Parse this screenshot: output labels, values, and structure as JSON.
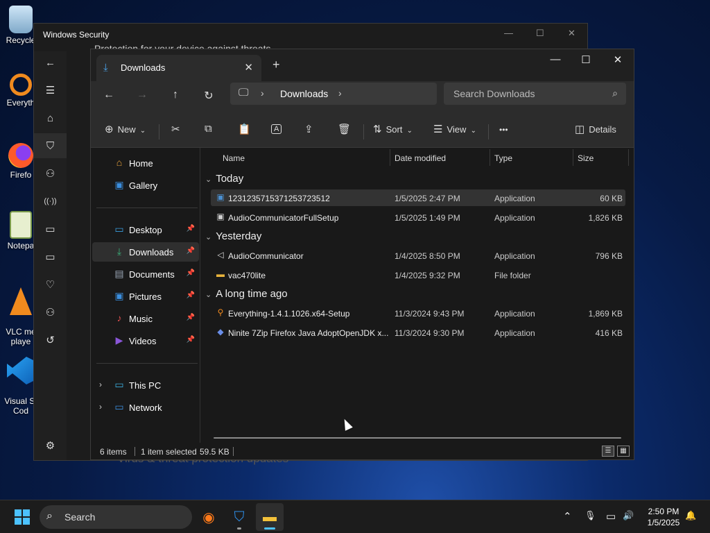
{
  "desktop": {
    "icons": [
      {
        "label": "Recycle",
        "icon": "recycle-bin-icon"
      },
      {
        "label": "Everyth",
        "icon": "everything-search-icon"
      },
      {
        "label": "Firefo",
        "icon": "firefox-icon"
      },
      {
        "label": "Notepa",
        "icon": "notepad-icon"
      },
      {
        "label": "VLC me\nplaye",
        "icon": "vlc-icon"
      },
      {
        "label": "Visual St\nCod",
        "icon": "vscode-icon"
      }
    ]
  },
  "security_window": {
    "title": "Windows Security",
    "peek_text": "Protection for your device against threats",
    "peek_bottom": "Virus & threat protection updates",
    "controls": {
      "minimize": "—",
      "maximize": "☐",
      "close": "✕"
    },
    "rail": {
      "back": "←",
      "menu": "☰",
      "home": "⌂",
      "shield": "⛉",
      "account": "⚇",
      "network": "((·))",
      "app": "▭",
      "device": "▭",
      "health": "♡",
      "family": "⚇",
      "history": "↺",
      "settings": "⚙"
    }
  },
  "explorer": {
    "tab": {
      "title": "Downloads",
      "close": "✕",
      "new": "+"
    },
    "window_controls": {
      "minimize": "—",
      "maximize": "☐",
      "close": "✕"
    },
    "nav": {
      "back": "←",
      "forward": "→",
      "up": "↑",
      "refresh": "↻"
    },
    "address": {
      "pc_icon": "🖵",
      "sep": "›",
      "crumb": "Downloads",
      "sep2": "›"
    },
    "search": {
      "placeholder": "Search Downloads",
      "icon": "⌕"
    },
    "commands": {
      "new": "New",
      "sort": "Sort",
      "view": "View",
      "more": "•••",
      "details": "Details",
      "cut": "✂",
      "copy": "⧉",
      "paste": "📋",
      "rename": "A",
      "share": "⇪",
      "delete": "🗑",
      "chev": "⌄"
    },
    "nav_pane": {
      "items": [
        {
          "label": "Home",
          "icon": "⌂",
          "color": "#e8a33c",
          "pinned": false
        },
        {
          "label": "Gallery",
          "icon": "▣",
          "color": "#3b8ede",
          "pinned": false
        },
        {
          "label": "Desktop",
          "icon": "▭",
          "color": "#3b9fe0",
          "pinned": true
        },
        {
          "label": "Downloads",
          "icon": "⤓",
          "color": "#3bb07a",
          "pinned": true
        },
        {
          "label": "Documents",
          "icon": "▤",
          "color": "#9aa6b4",
          "pinned": true
        },
        {
          "label": "Pictures",
          "icon": "▣",
          "color": "#3b8ede",
          "pinned": true
        },
        {
          "label": "Music",
          "icon": "♪",
          "color": "#e05050",
          "pinned": true
        },
        {
          "label": "Videos",
          "icon": "▶",
          "color": "#8a56d8",
          "pinned": true
        },
        {
          "label": "This PC",
          "icon": "▭",
          "color": "#3bb0e0",
          "pinned": false
        },
        {
          "label": "Network",
          "icon": "▭",
          "color": "#3b8ede",
          "pinned": false
        }
      ],
      "pin_glyph": "📌",
      "expand_glyph": "›"
    },
    "columns": {
      "name": "Name",
      "date": "Date modified",
      "type": "Type",
      "size": "Size"
    },
    "groups": [
      {
        "label": "Today",
        "collapse": "⌄"
      },
      {
        "label": "Yesterday",
        "collapse": "⌄"
      },
      {
        "label": "A long time ago",
        "collapse": "⌄"
      }
    ],
    "files": [
      {
        "name": "1231235715371253723512",
        "date": "1/5/2025 2:47 PM",
        "type": "Application",
        "size": "60 KB",
        "icon": "▣",
        "icon_color": "#4a8fd0"
      },
      {
        "name": "AudioCommunicatorFullSetup",
        "date": "1/5/2025 1:49 PM",
        "type": "Application",
        "size": "1,826 KB",
        "icon": "▣",
        "icon_color": "#cfcfcf"
      },
      {
        "name": "AudioCommunicator",
        "date": "1/4/2025 8:50 PM",
        "type": "Application",
        "size": "796 KB",
        "icon": "◁",
        "icon_color": "#dddddd"
      },
      {
        "name": "vac470lite",
        "date": "1/4/2025 9:32 PM",
        "type": "File folder",
        "size": "",
        "icon": "▬",
        "icon_color": "#e8b33c"
      },
      {
        "name": "Everything-1.4.1.1026.x64-Setup",
        "date": "11/3/2024 9:43 PM",
        "type": "Application",
        "size": "1,869 KB",
        "icon": "⚲",
        "icon_color": "#f08a1e"
      },
      {
        "name": "Ninite 7Zip Firefox Java AdoptOpenJDK x...",
        "date": "11/3/2024 9:30 PM",
        "type": "Application",
        "size": "416 KB",
        "icon": "◆",
        "icon_color": "#6a8ee8"
      }
    ],
    "status": {
      "count": "6 items",
      "selected": "1 item selected",
      "size": "59.5 KB"
    },
    "view_buttons": {
      "details": "☰",
      "tiles": "▦"
    }
  },
  "taskbar": {
    "search_label": "Search",
    "search_icon": "⌕",
    "apps": [
      {
        "name": "Firefox",
        "glyph": "◉",
        "color": "#ff7a1a"
      },
      {
        "name": "Windows Security",
        "glyph": "⛉",
        "color": "#2e8ee8"
      },
      {
        "name": "File Explorer",
        "glyph": "▬",
        "color": "#f3c13a"
      }
    ],
    "tray": {
      "chevron": "⌃",
      "mic": "🎙",
      "network": "▭",
      "volume": "🔊",
      "bell": "🔔"
    },
    "time": "2:50 PM",
    "date": "1/5/2025"
  },
  "colors": {
    "accent": "#4cc2ff",
    "explorer_bg": "#191919"
  }
}
